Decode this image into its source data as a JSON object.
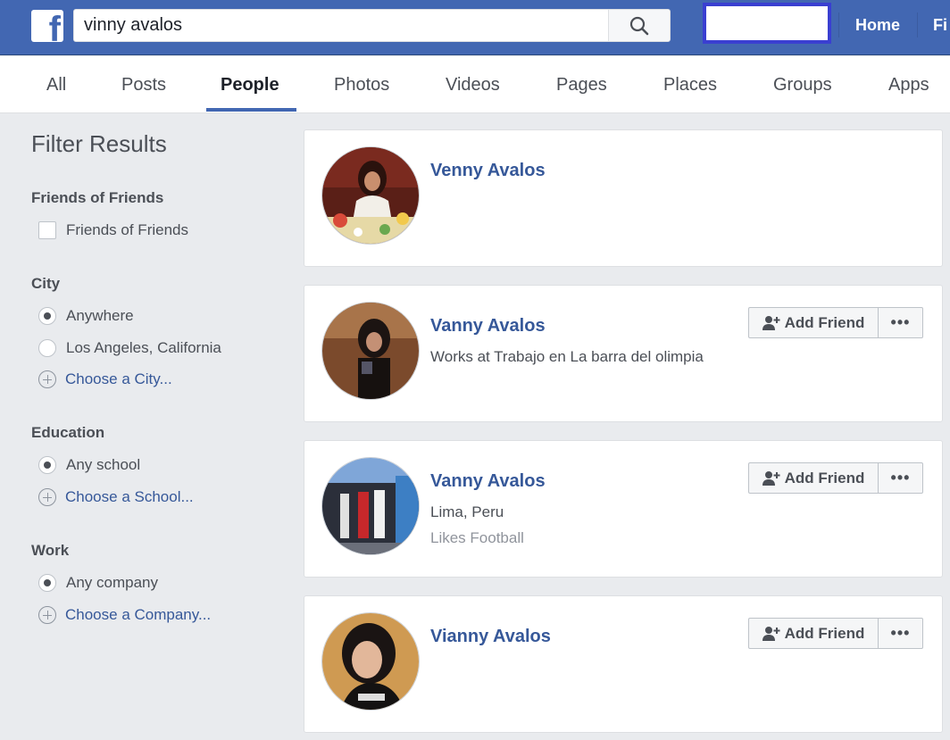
{
  "topbar": {
    "logo": "f",
    "search_value": "vinny avalos",
    "search_icon": "magnifier-icon",
    "nav": [
      "Home",
      "Fi"
    ]
  },
  "tabs": [
    {
      "label": "All"
    },
    {
      "label": "Posts"
    },
    {
      "label": "People",
      "active": true
    },
    {
      "label": "Photos"
    },
    {
      "label": "Videos"
    },
    {
      "label": "Pages"
    },
    {
      "label": "Places"
    },
    {
      "label": "Groups"
    },
    {
      "label": "Apps"
    }
  ],
  "sidebar": {
    "title": "Filter Results",
    "sections": [
      {
        "heading": "Friends of Friends",
        "options": [
          {
            "label": "Friends of Friends",
            "kind": "checkbox"
          }
        ]
      },
      {
        "heading": "City",
        "options": [
          {
            "label": "Anywhere",
            "kind": "radio",
            "selected": true
          },
          {
            "label": "Los Angeles, California",
            "kind": "radio"
          },
          {
            "label": "Choose a City...",
            "kind": "add"
          }
        ]
      },
      {
        "heading": "Education",
        "options": [
          {
            "label": "Any school",
            "kind": "radio",
            "selected": true
          },
          {
            "label": "Choose a School...",
            "kind": "add"
          }
        ]
      },
      {
        "heading": "Work",
        "options": [
          {
            "label": "Any company",
            "kind": "radio",
            "selected": true
          },
          {
            "label": "Choose a Company...",
            "kind": "add"
          }
        ]
      }
    ]
  },
  "results": [
    {
      "name": "Venny Avalos",
      "line1": "",
      "line2": "",
      "add_friend": false
    },
    {
      "name": "Vanny Avalos",
      "line1": "Works at Trabajo en La barra del olimpia",
      "line2": "",
      "add_friend": true
    },
    {
      "name": "Vanny Avalos",
      "line1": "Lima, Peru",
      "line2": "Likes Football",
      "add_friend": true
    },
    {
      "name": "Vianny Avalos",
      "line1": "",
      "line2": "",
      "add_friend": true
    }
  ],
  "buttons": {
    "add_friend": "Add Friend",
    "more": "•••"
  },
  "colors": {
    "brand": "#4267b2",
    "link": "#365899",
    "highlight": "#3a3fd1"
  }
}
